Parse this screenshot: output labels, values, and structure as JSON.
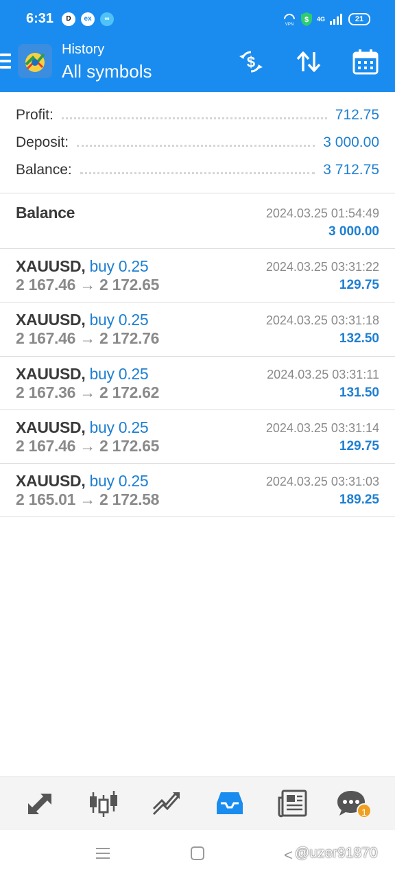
{
  "status_bar": {
    "time": "6:31",
    "network": "4G",
    "battery": "21"
  },
  "header": {
    "subtitle": "History",
    "title": "All symbols"
  },
  "summary": {
    "profit_label": "Profit:",
    "profit_value": "712.75",
    "deposit_label": "Deposit:",
    "deposit_value": "3 000.00",
    "balance_label": "Balance:",
    "balance_value": "3 712.75"
  },
  "balance_entry": {
    "title": "Balance",
    "datetime": "2024.03.25 01:54:49",
    "amount": "3 000.00"
  },
  "deals": [
    {
      "symbol": "XAUUSD,",
      "type": "buy 0.25",
      "prices": "2 167.46 → 2 172.65",
      "datetime": "2024.03.25 03:31:22",
      "profit": "129.75"
    },
    {
      "symbol": "XAUUSD,",
      "type": "buy 0.25",
      "prices": "2 167.46 → 2 172.76",
      "datetime": "2024.03.25 03:31:18",
      "profit": "132.50"
    },
    {
      "symbol": "XAUUSD,",
      "type": "buy 0.25",
      "prices": "2 167.36 → 2 172.62",
      "datetime": "2024.03.25 03:31:11",
      "profit": "131.50"
    },
    {
      "symbol": "XAUUSD,",
      "type": "buy 0.25",
      "prices": "2 167.46 → 2 172.65",
      "datetime": "2024.03.25 03:31:14",
      "profit": "129.75"
    },
    {
      "symbol": "XAUUSD,",
      "type": "buy 0.25",
      "prices": "2 165.01 → 2 172.58",
      "datetime": "2024.03.25 03:31:03",
      "profit": "189.25"
    }
  ],
  "bottom_nav": {
    "chat_badge": "1"
  },
  "watermark": "@uzer91870",
  "colors": {
    "accent": "#1a8cf0",
    "value_blue": "#1e7fd2",
    "badge_orange": "#f0a020"
  }
}
